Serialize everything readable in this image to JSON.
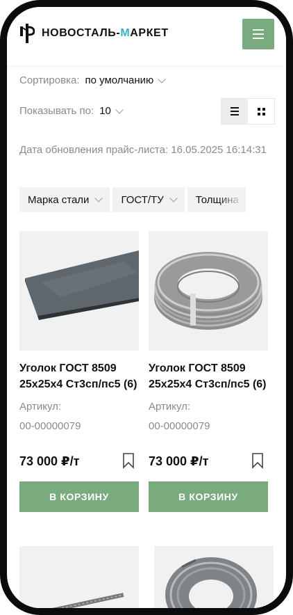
{
  "header": {
    "logo_text_1": "НОВОСТАЛЬ-",
    "logo_text_accent": "М",
    "logo_text_2": "АРКЕТ",
    "menu_icon": "hamburger-icon"
  },
  "toolbar": {
    "sort_label": "Сортировка:",
    "sort_value": "по умолчанию",
    "show_label": "Показывать по:",
    "show_value": "10",
    "view_list_icon": "list-view-icon",
    "view_grid_icon": "grid-view-icon"
  },
  "price_list_update": "Дата обновления прайс-листа:  16.05.2025 16:14:31",
  "filters": [
    {
      "label": "Марка стали"
    },
    {
      "label": "ГОСТ/ТУ"
    },
    {
      "label": "Толщина"
    }
  ],
  "products": [
    {
      "name": "Уголок ГОСТ 8509 25х25х4 Ст3сп/пс5 (6)",
      "sku_label": "Артикул:",
      "sku": "00-00000079",
      "price": "73 000 ₽/т",
      "cart_label": "В КОРЗИНУ",
      "image": "steel-sheet"
    },
    {
      "name": "Уголок ГОСТ 8509 25х25х4 Ст3сп/пс5 (6)",
      "sku_label": "Артикул:",
      "sku": "00-00000079",
      "price": "73 000 ₽/т",
      "cart_label": "В КОРЗИНУ",
      "image": "wire-coil"
    }
  ],
  "colors": {
    "accent": "#7aab7e",
    "logo_accent": "#33b3c8",
    "muted_text": "#8a8a8a",
    "chip_bg": "#f2f2f2"
  }
}
